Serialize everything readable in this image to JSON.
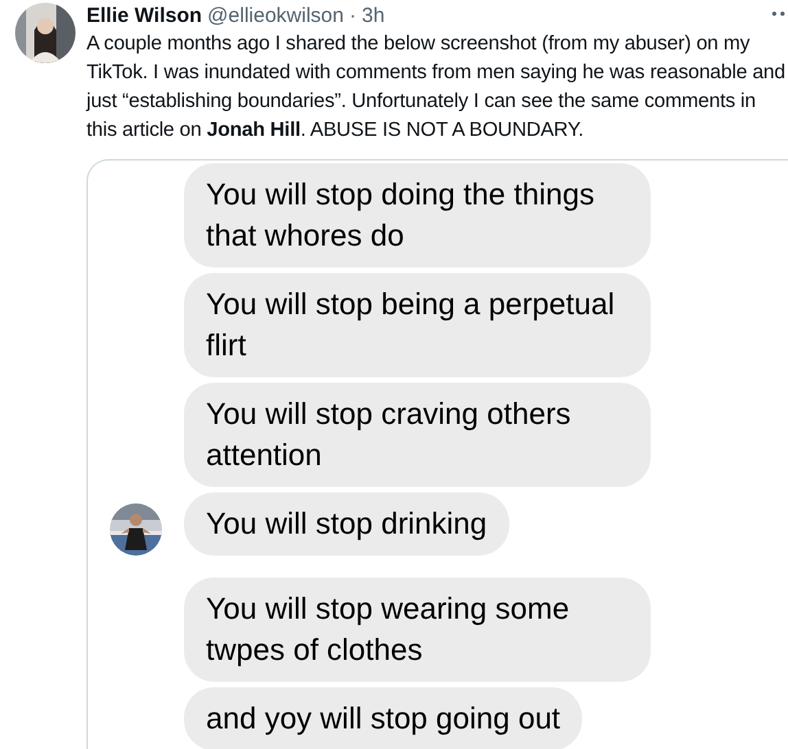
{
  "tweet": {
    "author": "Ellie Wilson",
    "handle": "@ellieokwilson",
    "separator": "·",
    "time": "3h",
    "text": "A couple months ago I shared the below screenshot (from my abuser) on my TikTok. I was inundated with comments from men saying he was reasonable and just “establishing boundaries”. Unfortunately I can see the same comments in this article on **Jonah Hill**. ABUSE IS NOT A BOUNDARY."
  },
  "screenshot": {
    "groups": [
      {
        "show_avatar": true,
        "messages": [
          "You will stop doing the things that whores do",
          "You will stop being a perpetual flirt",
          "You will stop craving others attention",
          "You will stop drinking"
        ]
      },
      {
        "show_avatar": false,
        "messages": [
          "You will stop wearing some twpes of clothes",
          "and yoy will stop going out"
        ]
      }
    ]
  }
}
